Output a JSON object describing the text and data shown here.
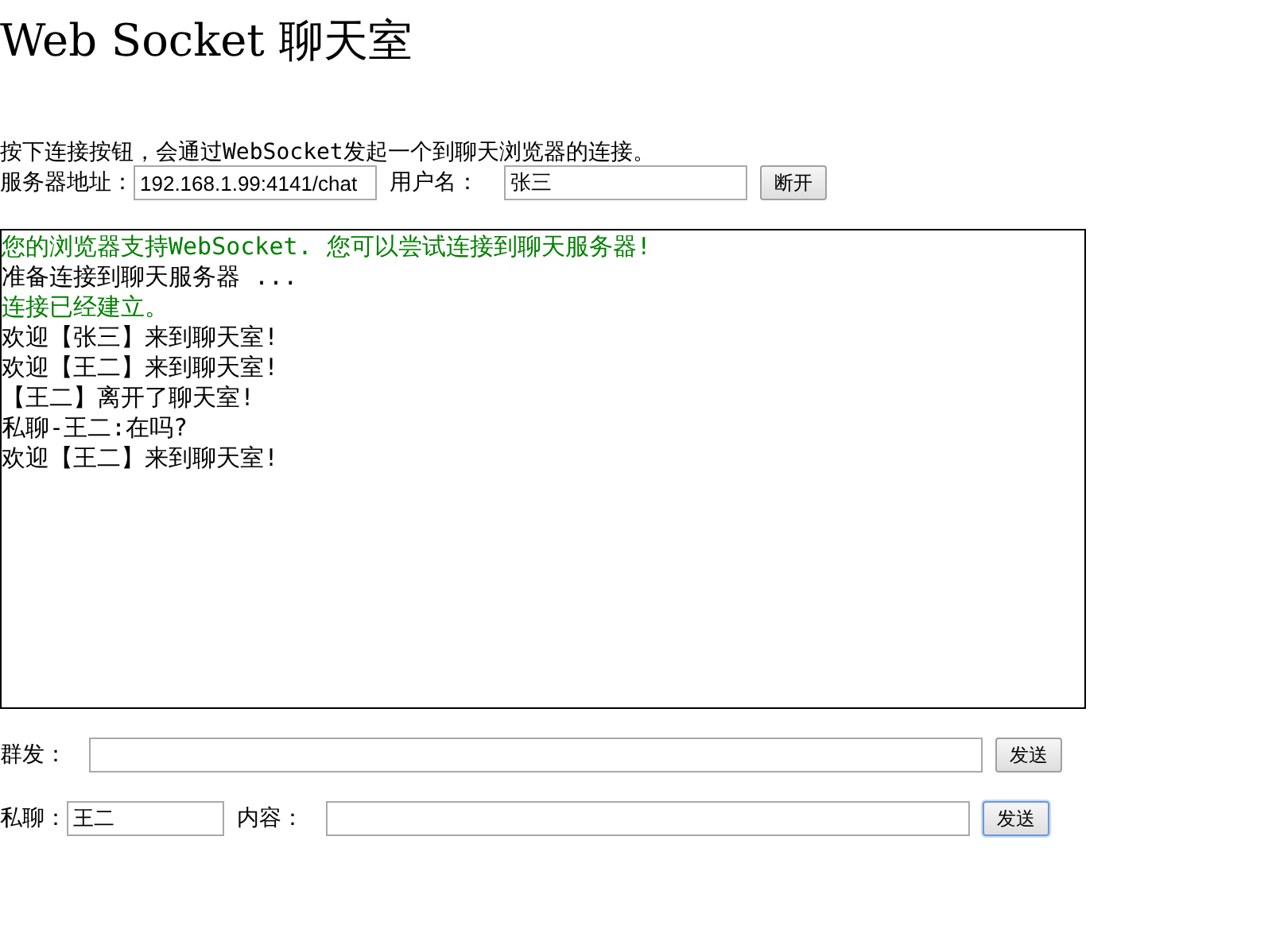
{
  "title": "Web Socket 聊天室",
  "intro": "按下连接按钮，会通过WebSocket发起一个到聊天浏览器的连接。",
  "connection": {
    "server_label": "服务器地址：",
    "server_value": "192.168.1.99:4141/chat",
    "user_label": "用户名：",
    "user_value": "张三",
    "button": "断开"
  },
  "log": [
    {
      "text": "您的浏览器支持WebSocket. 您可以尝试连接到聊天服务器!",
      "kind": "info"
    },
    {
      "text": "准备连接到聊天服务器 ...",
      "kind": "plain"
    },
    {
      "text": "连接已经建立。",
      "kind": "info"
    },
    {
      "text": "欢迎【张三】来到聊天室!",
      "kind": "plain"
    },
    {
      "text": "欢迎【王二】来到聊天室!",
      "kind": "plain"
    },
    {
      "text": "【王二】离开了聊天室!",
      "kind": "plain"
    },
    {
      "text": "私聊-王二:在吗?",
      "kind": "plain"
    },
    {
      "text": "欢迎【王二】来到聊天室!",
      "kind": "plain"
    }
  ],
  "broadcast": {
    "label": "群发：",
    "button": "发送",
    "focused": false
  },
  "private": {
    "label": "私聊：",
    "to_value": "王二",
    "content_label": "内容：",
    "button": "发送",
    "focused": true
  }
}
